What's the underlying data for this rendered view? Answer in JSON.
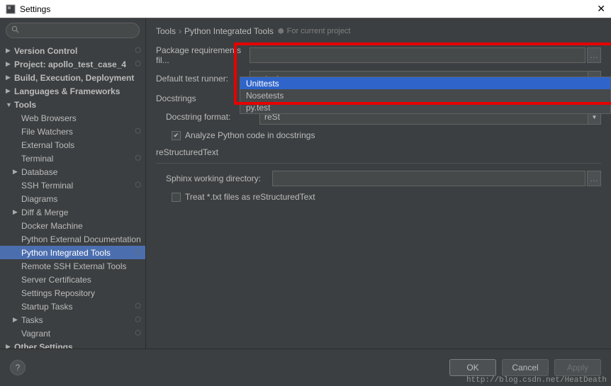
{
  "window": {
    "title": "Settings",
    "close_glyph": "✕"
  },
  "search": {
    "placeholder": ""
  },
  "sidebar": {
    "items": [
      {
        "label": "Version Control",
        "bold": true,
        "arrow": "col",
        "level": 0,
        "badge": "⬡"
      },
      {
        "label": "Project: apollo_test_case_4",
        "bold": true,
        "arrow": "col",
        "level": 0,
        "badge": "⬡"
      },
      {
        "label": "Build, Execution, Deployment",
        "bold": true,
        "arrow": "col",
        "level": 0
      },
      {
        "label": "Languages & Frameworks",
        "bold": true,
        "arrow": "col",
        "level": 0
      },
      {
        "label": "Tools",
        "bold": true,
        "arrow": "exp",
        "level": 0
      },
      {
        "label": "Web Browsers",
        "level": 1
      },
      {
        "label": "File Watchers",
        "level": 1,
        "badge": "⬡"
      },
      {
        "label": "External Tools",
        "level": 1
      },
      {
        "label": "Terminal",
        "level": 1,
        "badge": "⬡"
      },
      {
        "label": "Database",
        "level": 1,
        "arrow": "col"
      },
      {
        "label": "SSH Terminal",
        "level": 1,
        "badge": "⬡"
      },
      {
        "label": "Diagrams",
        "level": 1
      },
      {
        "label": "Diff & Merge",
        "level": 1,
        "arrow": "col"
      },
      {
        "label": "Docker Machine",
        "level": 1
      },
      {
        "label": "Python External Documentation",
        "level": 1
      },
      {
        "label": "Python Integrated Tools",
        "level": 1,
        "badge": "⬡",
        "selected": true
      },
      {
        "label": "Remote SSH External Tools",
        "level": 1
      },
      {
        "label": "Server Certificates",
        "level": 1
      },
      {
        "label": "Settings Repository",
        "level": 1
      },
      {
        "label": "Startup Tasks",
        "level": 1,
        "badge": "⬡"
      },
      {
        "label": "Tasks",
        "level": 1,
        "arrow": "col",
        "badge": "⬡"
      },
      {
        "label": "Vagrant",
        "level": 1,
        "badge": "⬡"
      },
      {
        "label": "Other Settings",
        "bold": true,
        "arrow": "col",
        "level": 0
      }
    ]
  },
  "breadcrumb": {
    "a": "Tools",
    "b": "Python Integrated Tools",
    "proj": "For current project"
  },
  "form": {
    "pkg_req_label": "Package requirements fil...",
    "pkg_req_value": "",
    "test_runner_label": "Default test runner:",
    "test_runner_value": "py.test",
    "test_runner_options": [
      "Unittests",
      "Nosetests",
      "py.test"
    ],
    "docstrings_title": "Docstrings",
    "docstring_format_label": "Docstring format:",
    "docstring_format_value": "reSt",
    "analyze_label": "Analyze Python code in docstrings",
    "analyze_checked": true,
    "restructured_title": "reStructuredText",
    "sphinx_label": "Sphinx working directory:",
    "sphinx_value": "",
    "treat_label": "Treat *.txt files as reStructuredText",
    "treat_checked": false
  },
  "buttons": {
    "ok": "OK",
    "cancel": "Cancel",
    "apply": "Apply",
    "help": "?"
  },
  "watermark": "http://blog.csdn.net/HeatDeath"
}
